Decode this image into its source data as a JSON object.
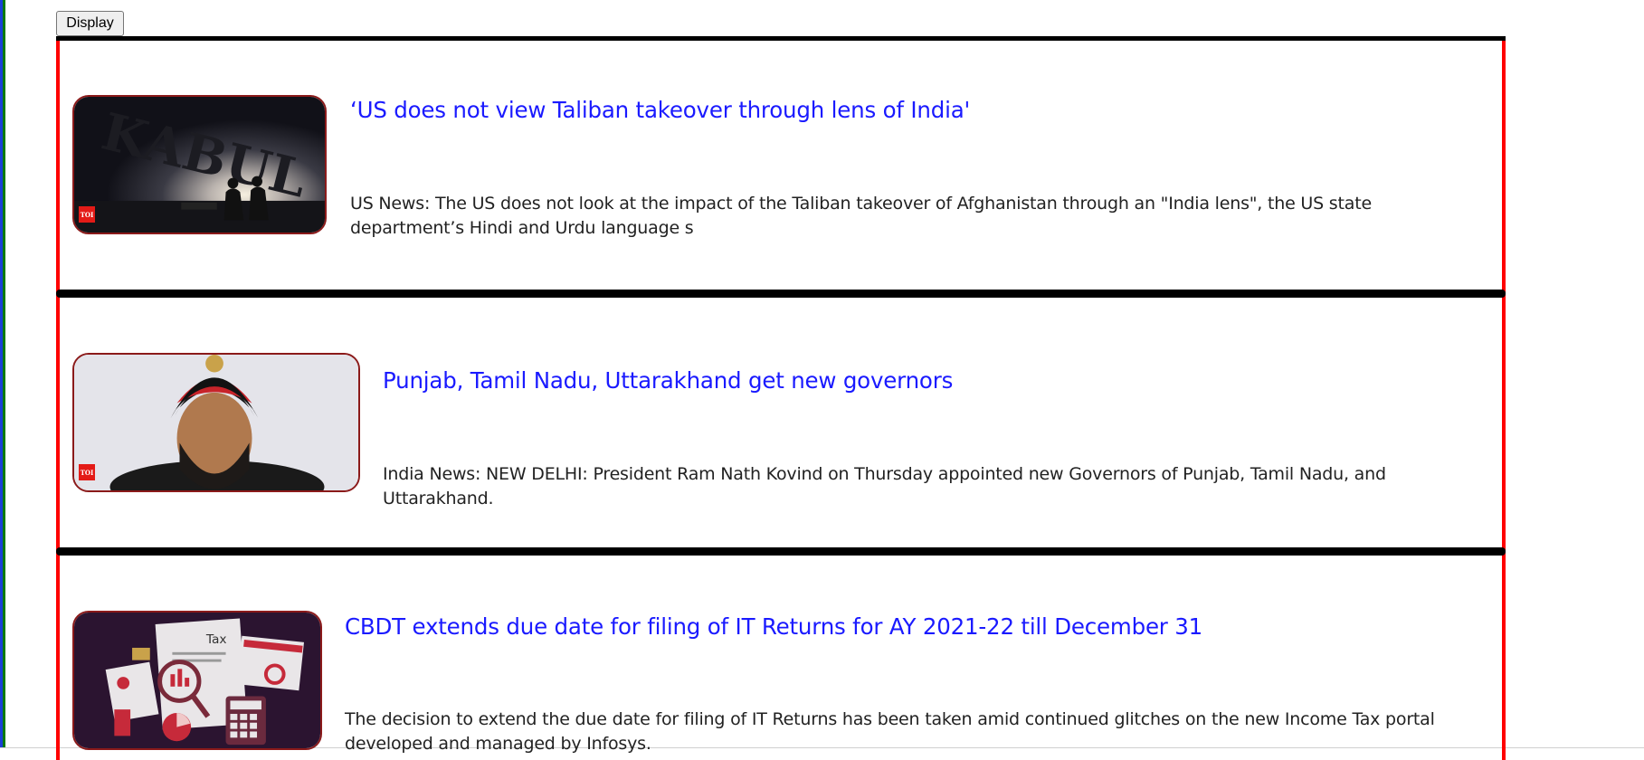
{
  "toolbar": {
    "display_label": "Display"
  },
  "articles": [
    {
      "title": "‘US does not view Taliban takeover through lens of India'",
      "description": "US News: The US does not look at the impact of the Taliban takeover of Afghanistan through an \"India lens\", the US state department’s Hindi and Urdu language s",
      "thumbnail_text": "KABUL",
      "badge": "TOI"
    },
    {
      "title": "Punjab, Tamil Nadu, Uttarakhand get new governors",
      "description": "India News: NEW DELHI: President Ram Nath Kovind on Thursday appointed new Governors of Punjab, Tamil Nadu, and Uttarakhand.",
      "badge": "TOI"
    },
    {
      "title": "CBDT extends due date for filing of IT Returns for AY 2021-22 till December 31",
      "description": "The decision to extend the due date for filing of IT Returns has been taken amid continued glitches on the new Income Tax portal developed and managed by Infosys.",
      "thumbnail_text": "Tax"
    }
  ],
  "colors": {
    "title_link": "#1a1aff",
    "frame_border": "#ff0000",
    "separator": "#000000",
    "left_accent": "#0a7a0a"
  }
}
